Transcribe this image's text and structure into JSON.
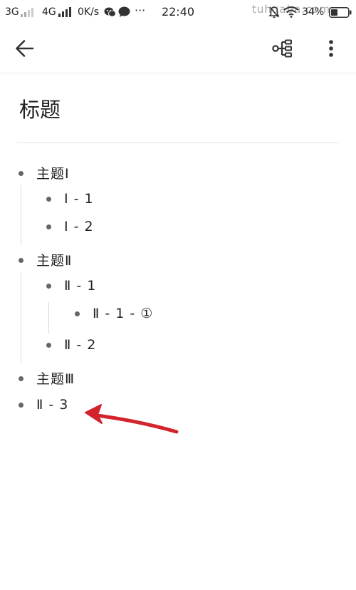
{
  "status_bar": {
    "network_1": "3G",
    "network_2": "4G",
    "speed": "0K/s",
    "more": "···",
    "time": "22:40",
    "battery": "34%",
    "watermark": "tuhuaba.com"
  },
  "app_bar": {
    "back_icon": "arrow-left-icon",
    "mindmap_icon": "mindmap-icon",
    "more_icon": "more-vert-icon"
  },
  "document": {
    "title": "标题",
    "outline": [
      {
        "label": "主题Ⅰ",
        "children": [
          {
            "label": "Ⅰ - 1"
          },
          {
            "label": "Ⅰ - 2"
          }
        ]
      },
      {
        "label": "主题Ⅱ",
        "children": [
          {
            "label": "Ⅱ - 1",
            "children": [
              {
                "label": "Ⅱ - 1 - ①"
              }
            ]
          },
          {
            "label": "Ⅱ - 2"
          }
        ]
      },
      {
        "label": "主题Ⅲ"
      },
      {
        "label": "Ⅱ - 3"
      }
    ]
  },
  "colors": {
    "annotation_arrow": "#d3242e",
    "bullet": "#666666",
    "text": "#222222"
  }
}
